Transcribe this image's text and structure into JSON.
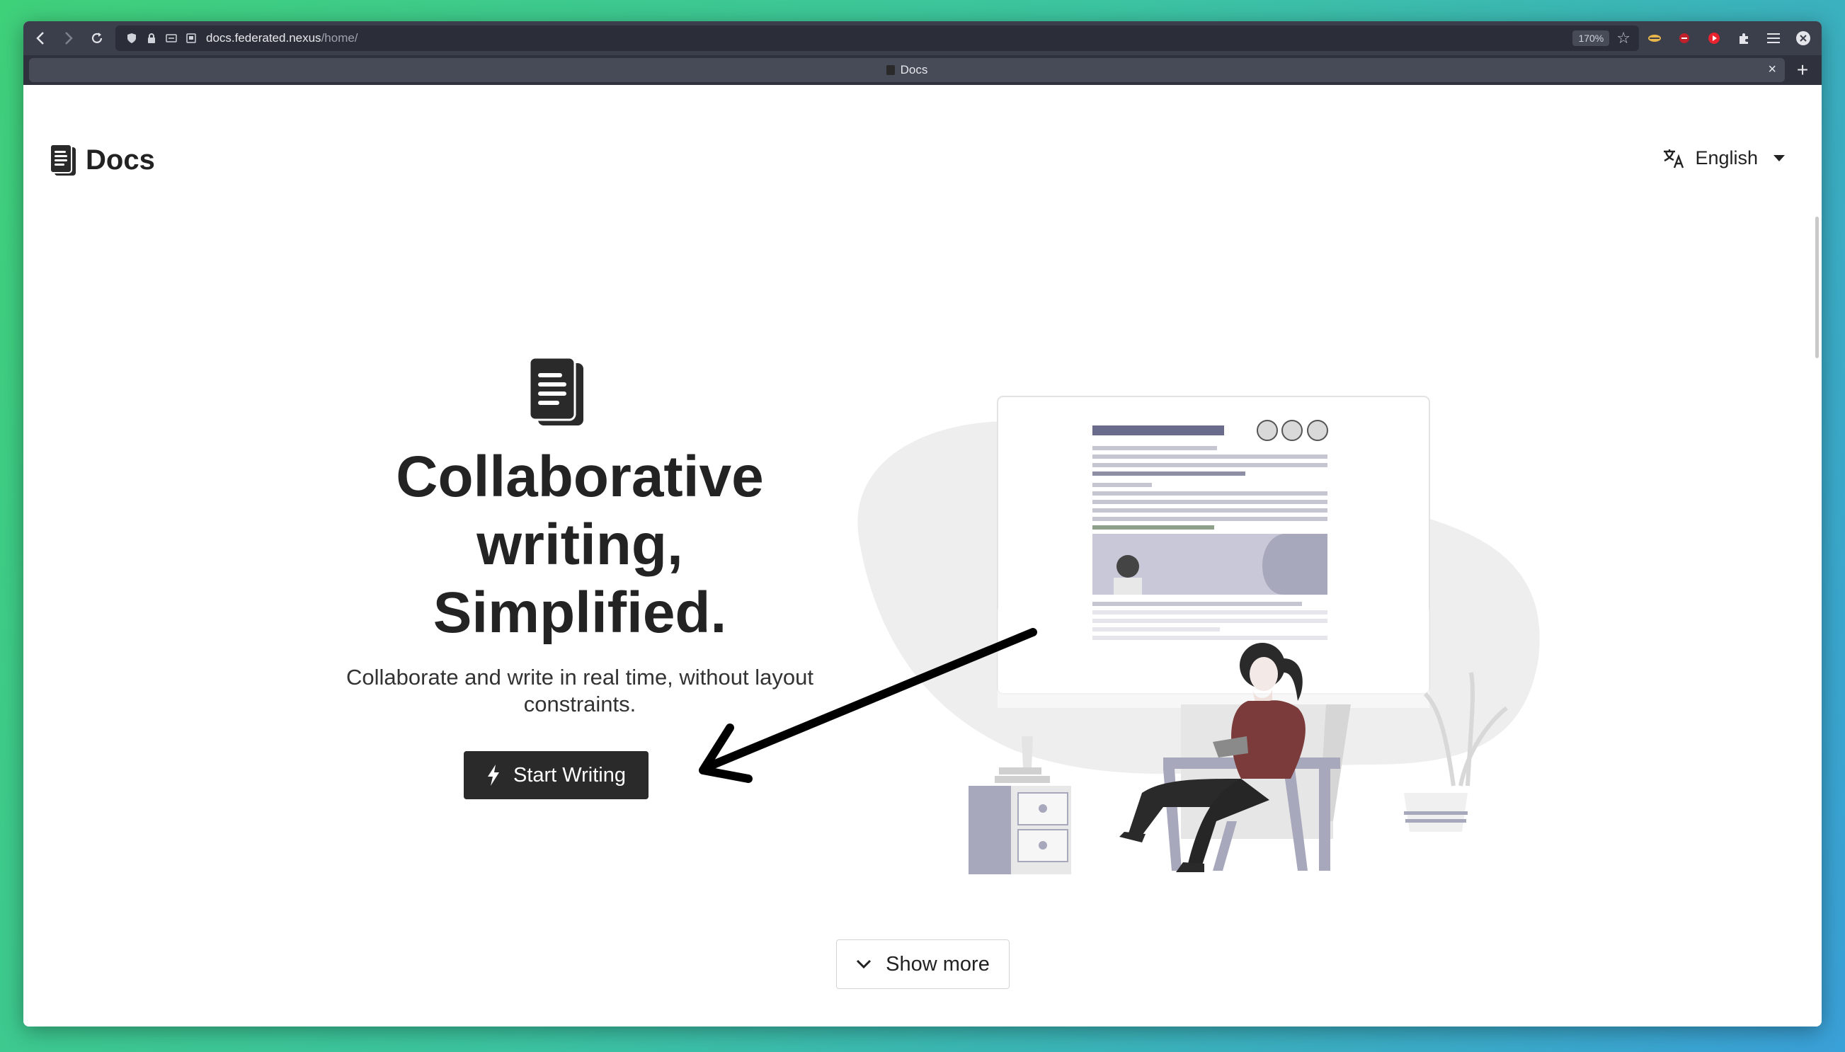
{
  "browser": {
    "url_host": "docs.federated.nexus",
    "url_path": "/home/",
    "url_prefix": "",
    "zoom": "170%",
    "tab_title": "Docs"
  },
  "header": {
    "logo_text": "Docs",
    "language": "English"
  },
  "hero": {
    "title_line1": "Collaborative",
    "title_line2": "writing,",
    "title_line3": "Simplified.",
    "subtitle": "Collaborate and write in real time, without layout constraints.",
    "start_button": "Start Writing"
  },
  "footer": {
    "show_more": "Show more"
  },
  "colors": {
    "primary": "#2a2a2a",
    "chrome": "#3b3f4c",
    "accent_doc": "#6b6b8e"
  }
}
